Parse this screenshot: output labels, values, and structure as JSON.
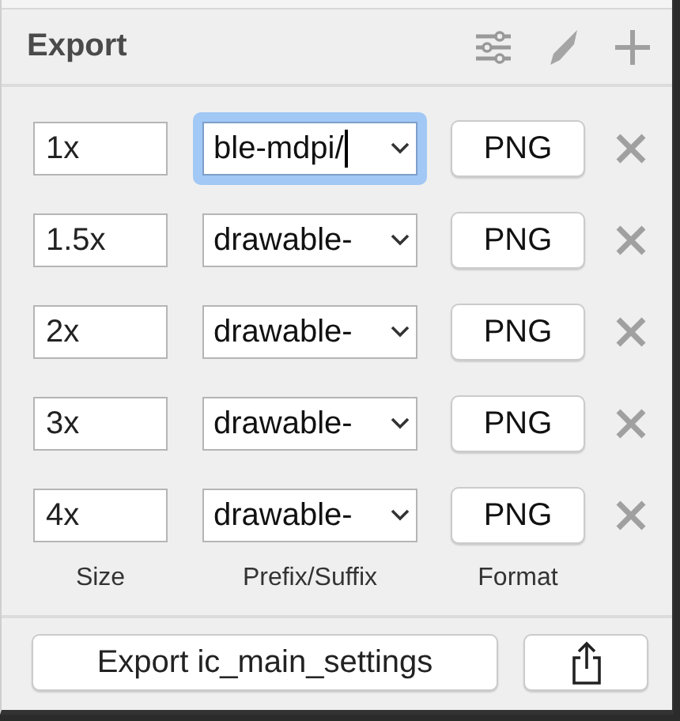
{
  "panel": {
    "title": "Export"
  },
  "rows": [
    {
      "size": "1x",
      "prefix": "ble-mdpi/",
      "format": "PNG",
      "focused": true
    },
    {
      "size": "1.5x",
      "prefix": "drawable-",
      "format": "PNG",
      "focused": false
    },
    {
      "size": "2x",
      "prefix": "drawable-",
      "format": "PNG",
      "focused": false
    },
    {
      "size": "3x",
      "prefix": "drawable-",
      "format": "PNG",
      "focused": false
    },
    {
      "size": "4x",
      "prefix": "drawable-",
      "format": "PNG",
      "focused": false
    }
  ],
  "column_labels": [
    "Size",
    "Prefix/Suffix",
    "Format"
  ],
  "export_button": "Export ic_main_settings"
}
